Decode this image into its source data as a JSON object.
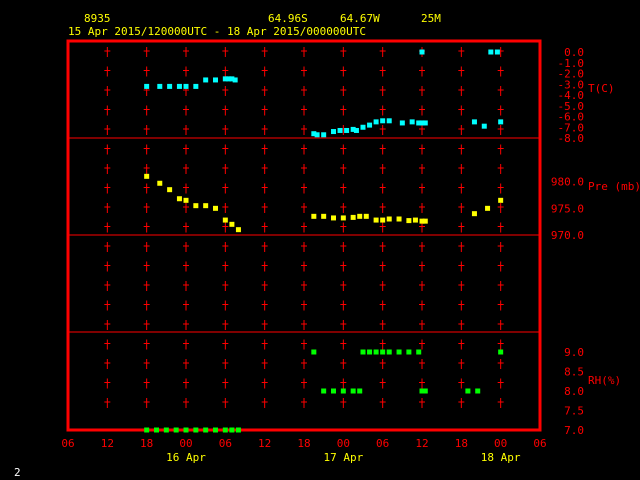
{
  "header": {
    "station_id": "8935",
    "lat": "64.96S",
    "lon": "64.67W",
    "elev": "25M",
    "period": "15 Apr 2015/120000UTC - 18 Apr 2015/000000UTC"
  },
  "footer": {
    "page_number": "2"
  },
  "colors": {
    "frame": "#ff0000",
    "axis_text": "#ff0000",
    "header_text": "#ffff00",
    "date_text": "#ffff00",
    "temp": "#00ffff",
    "pressure": "#ffff00",
    "rh": "#00ff00",
    "background": "#000000"
  },
  "chart_data": {
    "type": "scatter",
    "x_unit": "hours",
    "x_ticks": [
      {
        "hour": 6,
        "label": "06"
      },
      {
        "hour": 12,
        "label": "12"
      },
      {
        "hour": 18,
        "label": "18"
      },
      {
        "hour": 24,
        "label": "00"
      },
      {
        "hour": 30,
        "label": "06"
      },
      {
        "hour": 36,
        "label": "12"
      },
      {
        "hour": 42,
        "label": "18"
      },
      {
        "hour": 48,
        "label": "00"
      },
      {
        "hour": 54,
        "label": "06"
      },
      {
        "hour": 60,
        "label": "12"
      },
      {
        "hour": 66,
        "label": "18"
      },
      {
        "hour": 72,
        "label": "00"
      },
      {
        "hour": 78,
        "label": "06"
      }
    ],
    "date_labels": [
      {
        "hour": 24,
        "label": "16 Apr"
      },
      {
        "hour": 48,
        "label": "17 Apr"
      },
      {
        "hour": 72,
        "label": "18 Apr"
      }
    ],
    "xlim": [
      6,
      78
    ],
    "panels": [
      {
        "name": "T(C)",
        "ylim": [
          -8,
          0
        ],
        "tick_values": [
          0,
          -1,
          -2,
          -3,
          -4,
          -5,
          -6,
          -7,
          -8
        ],
        "tick_labels": [
          "0.0",
          "-1.0",
          "-2.0",
          "-3.0",
          "-4.0",
          "-5.0",
          "-6.0",
          "-7.0",
          "-8.0"
        ],
        "color_key": "temp",
        "points": [
          [
            18,
            -3.2
          ],
          [
            20,
            -3.2
          ],
          [
            21.5,
            -3.2
          ],
          [
            23,
            -3.2
          ],
          [
            24,
            -3.2
          ],
          [
            25.5,
            -3.2
          ],
          [
            27,
            -2.6
          ],
          [
            28.5,
            -2.6
          ],
          [
            30,
            -2.5
          ],
          [
            30.5,
            -2.5
          ],
          [
            31,
            -2.5
          ],
          [
            31.5,
            -2.6
          ],
          [
            43.5,
            -7.6
          ],
          [
            44,
            -7.7
          ],
          [
            45,
            -7.7
          ],
          [
            46.5,
            -7.4
          ],
          [
            47.5,
            -7.3
          ],
          [
            48.5,
            -7.3
          ],
          [
            49.5,
            -7.2
          ],
          [
            50,
            -7.3
          ],
          [
            51,
            -7.0
          ],
          [
            52,
            -6.8
          ],
          [
            53,
            -6.5
          ],
          [
            54,
            -6.4
          ],
          [
            55,
            -6.4
          ],
          [
            57,
            -6.6
          ],
          [
            58.5,
            -6.5
          ],
          [
            59.5,
            -6.6
          ],
          [
            60,
            -6.6
          ],
          [
            60.5,
            -6.6
          ],
          [
            60,
            0.0
          ],
          [
            68,
            -6.5
          ],
          [
            69.5,
            -6.9
          ],
          [
            70.5,
            0.0
          ],
          [
            71.5,
            0.0
          ],
          [
            72,
            -6.5
          ]
        ]
      },
      {
        "name": "Pre (mb)",
        "ylim": [
          970,
          982
        ],
        "tick_values": [
          980,
          975,
          970
        ],
        "tick_labels": [
          "980.0",
          "975.0",
          "970.0"
        ],
        "color_key": "pressure",
        "points": [
          [
            18,
            981.0
          ],
          [
            20,
            979.7
          ],
          [
            21.5,
            978.5
          ],
          [
            23,
            976.8
          ],
          [
            24,
            976.5
          ],
          [
            25.5,
            975.5
          ],
          [
            27,
            975.5
          ],
          [
            28.5,
            975.0
          ],
          [
            30,
            972.8
          ],
          [
            31,
            972.0
          ],
          [
            32,
            971.0
          ],
          [
            43.5,
            973.5
          ],
          [
            45,
            973.5
          ],
          [
            46.5,
            973.2
          ],
          [
            48,
            973.2
          ],
          [
            49.5,
            973.3
          ],
          [
            50.5,
            973.5
          ],
          [
            51.5,
            973.5
          ],
          [
            53,
            972.8
          ],
          [
            54,
            972.8
          ],
          [
            55,
            973.0
          ],
          [
            56.5,
            973.0
          ],
          [
            58,
            972.7
          ],
          [
            59,
            972.8
          ],
          [
            60,
            972.6
          ],
          [
            60.5,
            972.6
          ],
          [
            68,
            974.0
          ],
          [
            70,
            975.0
          ],
          [
            72,
            976.5
          ]
        ]
      },
      {
        "name": "RH(%)",
        "ylim": [
          7,
          9
        ],
        "tick_values": [
          9,
          8.5,
          8,
          7.5,
          7
        ],
        "tick_labels": [
          "9.0",
          "8.5",
          "8.0",
          "7.5",
          "7.0"
        ],
        "color_key": "rh",
        "points": [
          [
            18,
            7.0
          ],
          [
            19.5,
            7.0
          ],
          [
            21,
            7.0
          ],
          [
            22.5,
            7.0
          ],
          [
            24,
            7.0
          ],
          [
            25.5,
            7.0
          ],
          [
            27,
            7.0
          ],
          [
            28.5,
            7.0
          ],
          [
            30,
            7.0
          ],
          [
            31,
            7.0
          ],
          [
            32,
            7.0
          ],
          [
            43.5,
            9.0
          ],
          [
            45,
            8.0
          ],
          [
            46.5,
            8.0
          ],
          [
            48,
            8.0
          ],
          [
            49.5,
            8.0
          ],
          [
            50.5,
            8.0
          ],
          [
            51,
            9.0
          ],
          [
            52,
            9.0
          ],
          [
            53,
            9.0
          ],
          [
            54,
            9.0
          ],
          [
            55,
            9.0
          ],
          [
            56.5,
            9.0
          ],
          [
            58,
            9.0
          ],
          [
            59.5,
            9.0
          ],
          [
            60,
            8.0
          ],
          [
            60.5,
            8.0
          ],
          [
            67,
            8.0
          ],
          [
            68.5,
            8.0
          ],
          [
            72,
            9.0
          ]
        ]
      }
    ]
  }
}
